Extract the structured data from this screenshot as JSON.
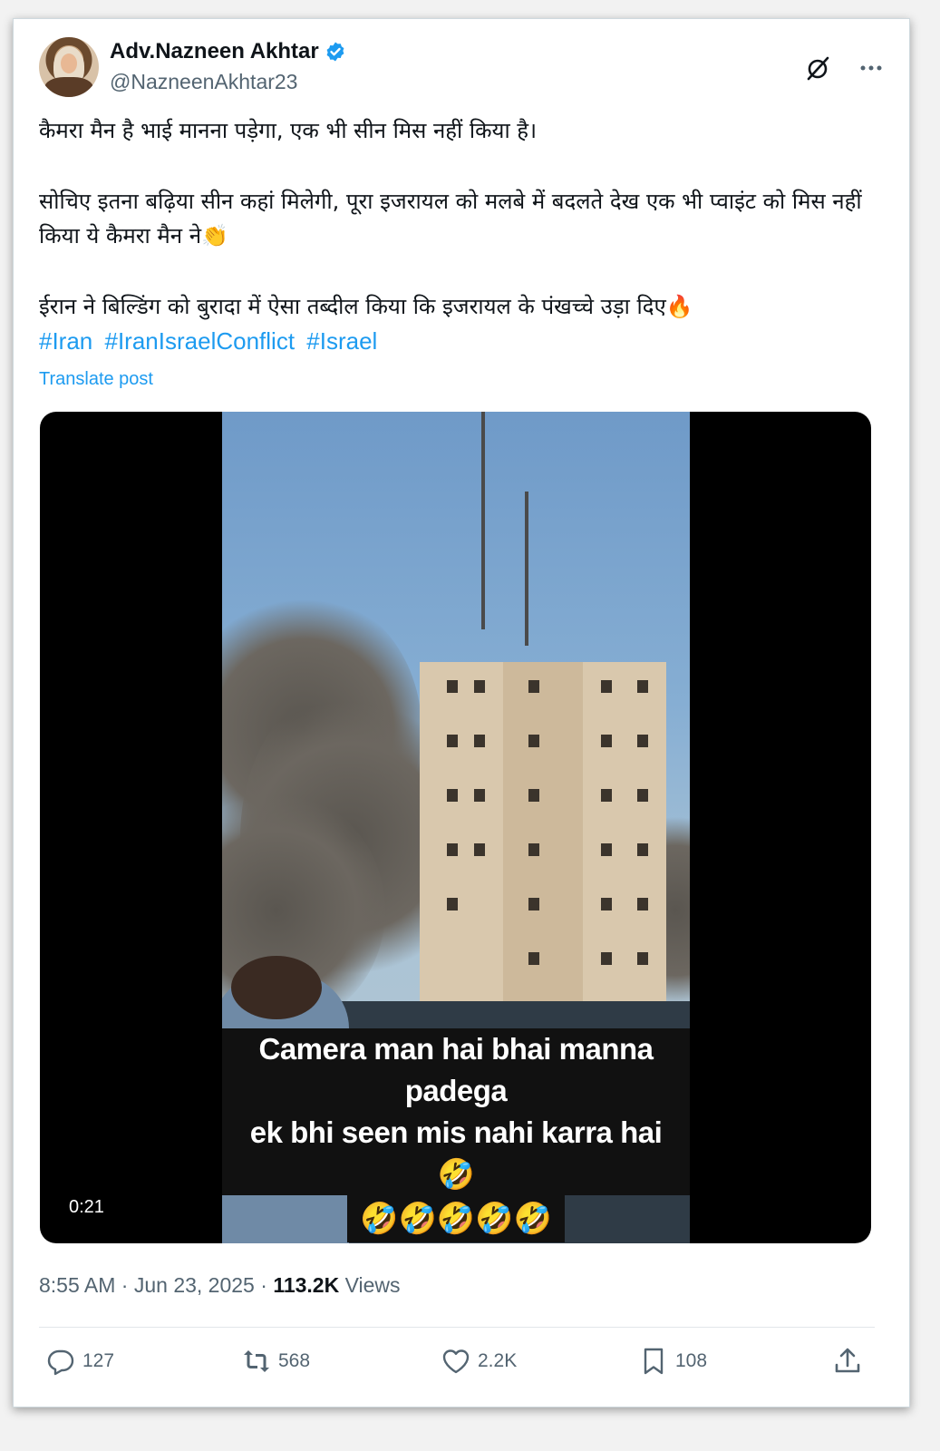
{
  "author": {
    "name": "Adv.Nazneen Akhtar",
    "handle": "@NazneenAkhtar23",
    "verified": true
  },
  "post": {
    "paragraph1": "कैमरा मैन है भाई मानना पड़ेगा, एक भी सीन मिस नहीं किया है।",
    "paragraph2": "सोचिए इतना बढ़िया सीन कहां मिलेगी, पूरा इजरायल को मलबे में बदलते देख एक भी प्वाइंट को मिस नहीं किया ये कैमरा मैन ने👏",
    "paragraph3": "ईरान ने बिल्डिंग को बुरादा में ऐसा तब्दील किया कि इजरायल के पंखच्चे उड़ा दिए🔥",
    "hashtags": [
      "#Iran",
      "#IranIsraelConflict",
      "#Israel"
    ],
    "translate_label": "Translate post"
  },
  "video": {
    "caption_line1": "Camera man hai bhai manna padega",
    "caption_line2": "ek bhi seen mis nahi karra hai 🤣",
    "caption_emojis": "🤣🤣🤣🤣🤣",
    "duration": "0:21"
  },
  "meta": {
    "time": "8:55 AM",
    "date": "Jun 23, 2025",
    "views_count": "113.2K",
    "views_label": "Views",
    "separator": "·"
  },
  "actions": {
    "replies": "127",
    "reposts": "568",
    "likes": "2.2K",
    "bookmarks": "108"
  },
  "icons": [
    "verified-badge-icon",
    "grok-icon",
    "more-icon",
    "reply-icon",
    "repost-icon",
    "like-icon",
    "bookmark-icon",
    "share-icon"
  ],
  "colors": {
    "link": "#1d9bf0",
    "secondary_text": "#536471",
    "primary_text": "#0f1419"
  }
}
